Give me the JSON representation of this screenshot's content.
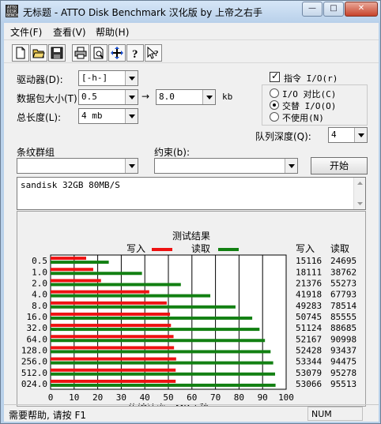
{
  "window": {
    "title": "无标题 - ATTO Disk Benchmark 汉化版 by 上帝之右手",
    "icon_text": "ATTO DISK BENCH"
  },
  "titlebar_buttons": {
    "minimize": "—",
    "maximize": "□",
    "close": "✕"
  },
  "menu": [
    {
      "label": "文件(F)"
    },
    {
      "label": "查看(V)"
    },
    {
      "label": "帮助(H)"
    }
  ],
  "toolbar": {
    "icons": [
      "new-file-icon",
      "open-folder-icon",
      "save-disk-icon",
      "print-icon",
      "print-preview-icon",
      "move-cross-icon",
      "help-icon",
      "context-help-icon"
    ]
  },
  "settings": {
    "drive_label": "驱动器(D):",
    "drive_value": "[-h-]",
    "transfer_label": "数据包大小(T):",
    "transfer_from": "0.5",
    "transfer_arrow": "→",
    "transfer_to": "8.0",
    "transfer_unit": "kb",
    "length_label": "总长度(L):",
    "length_value": "4 mb",
    "direct_io_label": "指令 I/O(r)",
    "direct_io_checked": "✓",
    "io_compare": "I/O 对比(C)",
    "overlapped_io": "交替 I/O(O)",
    "neither": "不使用(N)",
    "queue_label": "队列深度(Q):",
    "queue_value": "4",
    "stripe_label": "条纹群组",
    "constraint_label": "约束(b):",
    "start_button": "开始"
  },
  "notes": "sandisk 32GB 80MB/S",
  "legend": {
    "write_label": "写入",
    "read_label": "读取",
    "write_color": "#ee1111",
    "read_color": "#128012"
  },
  "chart_data": {
    "type": "bar",
    "title": "测试结果",
    "xlabel": "传输速率 - MB / 秒",
    "xlim": [
      0,
      100
    ],
    "xticks": [
      "0",
      "10",
      "20",
      "30",
      "40",
      "50",
      "60",
      "70",
      "80",
      "90",
      "100"
    ],
    "categories": [
      "0.5",
      "1.0",
      "2.0",
      "4.0",
      "8.0",
      "16.0",
      "32.0",
      "64.0",
      "128.0",
      "256.0",
      "512.0",
      "024.0"
    ],
    "series": [
      {
        "name": "写入",
        "values": [
          15.1,
          18.1,
          21.4,
          41.9,
          49.3,
          50.7,
          51.1,
          52.2,
          52.4,
          53.3,
          53.1,
          53.1
        ]
      },
      {
        "name": "读取",
        "values": [
          24.7,
          38.8,
          55.3,
          67.8,
          78.5,
          85.6,
          88.7,
          91.0,
          93.4,
          94.5,
          95.3,
          95.5
        ]
      }
    ],
    "table_headers": [
      "写入",
      "读取"
    ],
    "table_rows": [
      [
        "15116",
        "24695"
      ],
      [
        "18111",
        "38762"
      ],
      [
        "21376",
        "55273"
      ],
      [
        "41918",
        "67793"
      ],
      [
        "49283",
        "78514"
      ],
      [
        "50745",
        "85555"
      ],
      [
        "51124",
        "88685"
      ],
      [
        "52167",
        "90998"
      ],
      [
        "52428",
        "93437"
      ],
      [
        "53344",
        "94475"
      ],
      [
        "53079",
        "95278"
      ],
      [
        "53066",
        "95513"
      ]
    ]
  },
  "status": {
    "help_text": "需要帮助, 请按 F1",
    "num": "NUM"
  }
}
